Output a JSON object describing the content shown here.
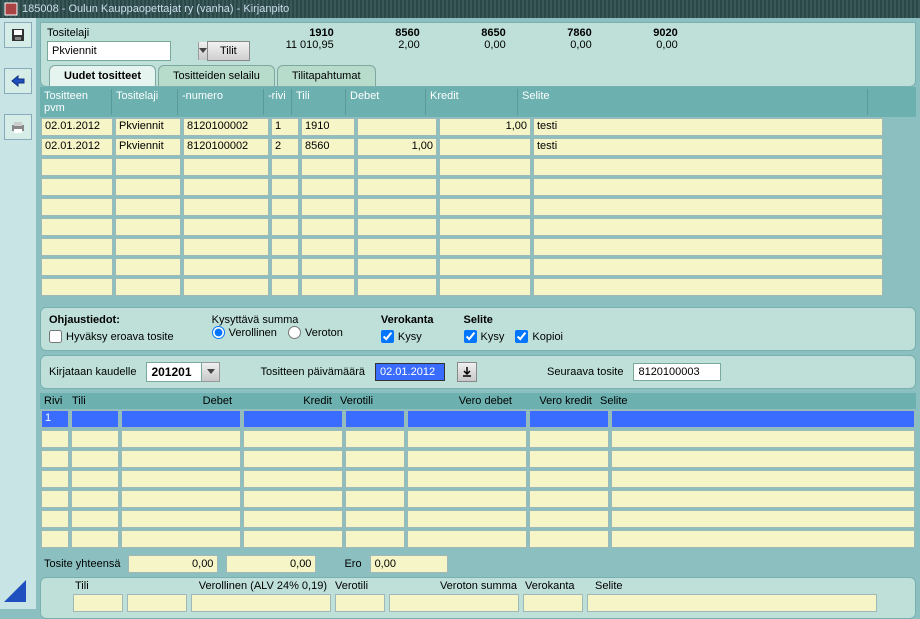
{
  "titlebar": "185008 - Oulun Kauppaopettajat ry (vanha) - Kirjanpito",
  "toprow": {
    "tositelaji_label": "Tositelaji",
    "tositelaji_value": "Pkviennit",
    "tilit_label": "Tilit"
  },
  "accounts": [
    {
      "num": "1910",
      "val": "11 010,95"
    },
    {
      "num": "8560",
      "val": "2,00"
    },
    {
      "num": "8650",
      "val": "0,00"
    },
    {
      "num": "7860",
      "val": "0,00"
    },
    {
      "num": "9020",
      "val": "0,00"
    }
  ],
  "tabs": {
    "t1": "Uudet tositteet",
    "t2": "Tositteiden selailu",
    "t3": "Tilitapahtumat"
  },
  "grid1": {
    "hdr": {
      "pvm": "Tositteen pvm",
      "laji": "Tositelaji",
      "numero": "-numero",
      "rivi": "-rivi",
      "tili": "Tili",
      "debet": "Debet",
      "kredit": "Kredit",
      "selite": "Selite"
    },
    "rows": [
      {
        "pvm": "02.01.2012",
        "laji": "Pkviennit",
        "numero": "8120100002",
        "rivi": "1",
        "tili": "1910",
        "debet": "",
        "kredit": "1,00",
        "selite": "testi"
      },
      {
        "pvm": "02.01.2012",
        "laji": "Pkviennit",
        "numero": "8120100002",
        "rivi": "2",
        "tili": "8560",
        "debet": "1,00",
        "kredit": "",
        "selite": "testi"
      }
    ]
  },
  "ohj": {
    "title": "Ohjaustiedot:",
    "chk_hyvaksy": "Hyväksy eroava tosite",
    "kysy_summa": "Kysyttävä summa",
    "verollinen": "Verollinen",
    "veroton": "Veroton",
    "verokanta": "Verokanta",
    "vk_kysy": "Kysy",
    "selite": "Selite",
    "sel_kysy": "Kysy",
    "sel_kopioi": "Kopioi"
  },
  "entrybar": {
    "kirjataan": "Kirjataan kaudelle",
    "period": "201201",
    "tosite_pvm_label": "Tositteen päivämäärä",
    "tosite_pvm_value": "02.01.2012",
    "seuraava_label": "Seuraava tosite",
    "seuraava_value": "8120100003"
  },
  "grid2": {
    "hdr": {
      "rivi": "Rivi",
      "tili": "Tili",
      "debet": "Debet",
      "kredit": "Kredit",
      "verotili": "Verotili",
      "verodebet": "Vero debet",
      "verokredit": "Vero kredit",
      "selite": "Selite"
    },
    "sel_row_num": "1"
  },
  "totals": {
    "label": "Tosite yhteensä",
    "debet": "0,00",
    "kredit": "0,00",
    "ero_label": "Ero",
    "ero": "0,00"
  },
  "bottom": {
    "hdr": {
      "tili": "Tili",
      "verollinen": "Verollinen (ALV 24% 0,19)",
      "verotili": "Verotili",
      "veroton": "Veroton summa",
      "verokanta": "Verokanta",
      "selite": "Selite"
    }
  }
}
